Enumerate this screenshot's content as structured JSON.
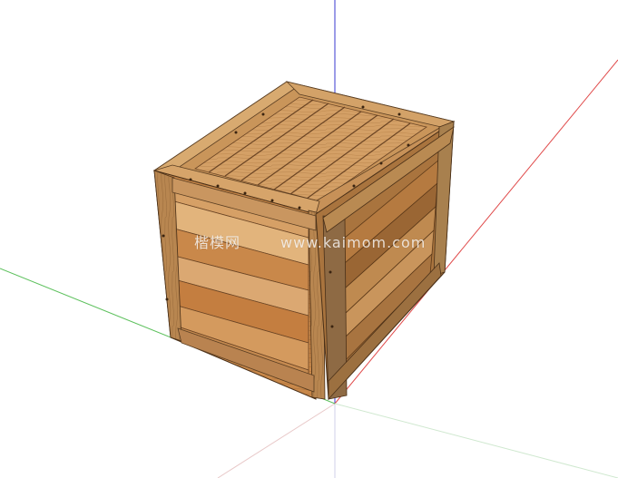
{
  "viewport": {
    "background": "#ffffff"
  },
  "axes": {
    "red_color": "#e04a4a",
    "green_color": "#5cc05c",
    "blue_color": "#3a3ad0",
    "inference_color": "#c8c8c8"
  },
  "model": {
    "object": "wooden-crate",
    "wood_light": "#d9a86a",
    "wood_mid": "#c68a4e",
    "wood_dark": "#8a5a2c",
    "wood_shadow": "#5a3e22",
    "frame_color": "#b98a52"
  },
  "watermark": {
    "site_name": "楷模网",
    "site_url": "www.kaimom.com"
  }
}
